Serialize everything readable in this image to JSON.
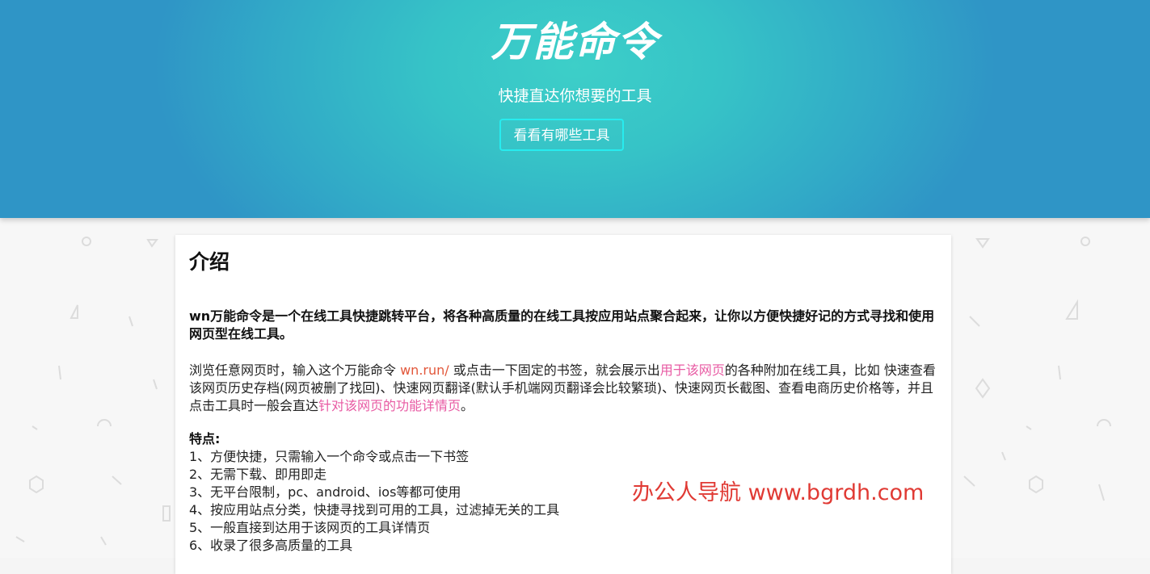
{
  "hero": {
    "title": "万能命令",
    "subtitle": "快捷直达你想要的工具",
    "button_label": "看看有哪些工具",
    "background_colors": [
      "#3dcfc8",
      "#2f95c6"
    ],
    "button_border_color": "#27ecef"
  },
  "intro": {
    "heading": "介绍",
    "lead": "wn万能命令是一个在线工具快捷跳转平台，将各种高质量的在线工具按应用站点聚合起来，让你以方便快捷好记的方式寻找和使用网页型在线工具。",
    "desc_part1": "浏览任意网页时，输入这个万能命令 ",
    "desc_link1": "wn.run/",
    "desc_part2": " 或点击一下固定的书签，就会展示出",
    "desc_link2": "用于该网页",
    "desc_part3": "的各种附加在线工具，比如 快速查看该网页历史存档(网页被删了找回)、快速网页翻译(默认手机端网页翻译会比较繁琐)、快速网页长截图、查看电商历史价格等，并且点击工具时一般会直达",
    "desc_link3": "针对该网页的功能详情页",
    "desc_part4": "。",
    "link_colors": {
      "orange": "#e2573a",
      "pink": "#e85aa3"
    }
  },
  "features": {
    "title": "特点:",
    "items": [
      "1、方便快捷，只需输入一个命令或点击一下书签",
      "2、无需下载、即用即走",
      "3、无平台限制，pc、android、ios等都可使用",
      "4、按应用站点分类，快捷寻找到可用的工具，过滤掉无关的工具",
      "5、一般直接到达用于该网页的工具详情页",
      "6、收录了很多高质量的工具"
    ]
  },
  "watermark": {
    "text": "办公人导航 www.bgrdh.com",
    "color": "#e03a34"
  }
}
